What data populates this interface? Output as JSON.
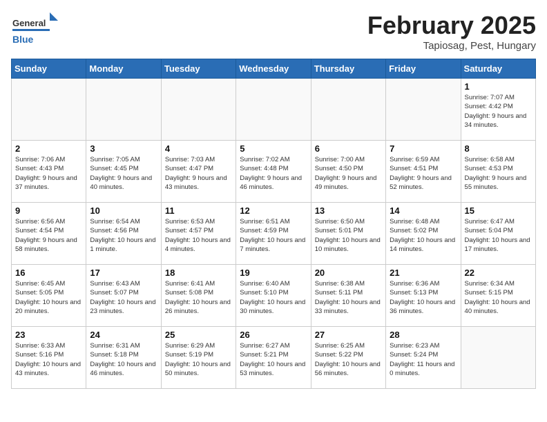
{
  "header": {
    "logo_general": "General",
    "logo_blue": "Blue",
    "month_title": "February 2025",
    "location": "Tapiosag, Pest, Hungary"
  },
  "days_of_week": [
    "Sunday",
    "Monday",
    "Tuesday",
    "Wednesday",
    "Thursday",
    "Friday",
    "Saturday"
  ],
  "weeks": [
    [
      {
        "day": "",
        "info": ""
      },
      {
        "day": "",
        "info": ""
      },
      {
        "day": "",
        "info": ""
      },
      {
        "day": "",
        "info": ""
      },
      {
        "day": "",
        "info": ""
      },
      {
        "day": "",
        "info": ""
      },
      {
        "day": "1",
        "info": "Sunrise: 7:07 AM\nSunset: 4:42 PM\nDaylight: 9 hours and 34 minutes."
      }
    ],
    [
      {
        "day": "2",
        "info": "Sunrise: 7:06 AM\nSunset: 4:43 PM\nDaylight: 9 hours and 37 minutes."
      },
      {
        "day": "3",
        "info": "Sunrise: 7:05 AM\nSunset: 4:45 PM\nDaylight: 9 hours and 40 minutes."
      },
      {
        "day": "4",
        "info": "Sunrise: 7:03 AM\nSunset: 4:47 PM\nDaylight: 9 hours and 43 minutes."
      },
      {
        "day": "5",
        "info": "Sunrise: 7:02 AM\nSunset: 4:48 PM\nDaylight: 9 hours and 46 minutes."
      },
      {
        "day": "6",
        "info": "Sunrise: 7:00 AM\nSunset: 4:50 PM\nDaylight: 9 hours and 49 minutes."
      },
      {
        "day": "7",
        "info": "Sunrise: 6:59 AM\nSunset: 4:51 PM\nDaylight: 9 hours and 52 minutes."
      },
      {
        "day": "8",
        "info": "Sunrise: 6:58 AM\nSunset: 4:53 PM\nDaylight: 9 hours and 55 minutes."
      }
    ],
    [
      {
        "day": "9",
        "info": "Sunrise: 6:56 AM\nSunset: 4:54 PM\nDaylight: 9 hours and 58 minutes."
      },
      {
        "day": "10",
        "info": "Sunrise: 6:54 AM\nSunset: 4:56 PM\nDaylight: 10 hours and 1 minute."
      },
      {
        "day": "11",
        "info": "Sunrise: 6:53 AM\nSunset: 4:57 PM\nDaylight: 10 hours and 4 minutes."
      },
      {
        "day": "12",
        "info": "Sunrise: 6:51 AM\nSunset: 4:59 PM\nDaylight: 10 hours and 7 minutes."
      },
      {
        "day": "13",
        "info": "Sunrise: 6:50 AM\nSunset: 5:01 PM\nDaylight: 10 hours and 10 minutes."
      },
      {
        "day": "14",
        "info": "Sunrise: 6:48 AM\nSunset: 5:02 PM\nDaylight: 10 hours and 14 minutes."
      },
      {
        "day": "15",
        "info": "Sunrise: 6:47 AM\nSunset: 5:04 PM\nDaylight: 10 hours and 17 minutes."
      }
    ],
    [
      {
        "day": "16",
        "info": "Sunrise: 6:45 AM\nSunset: 5:05 PM\nDaylight: 10 hours and 20 minutes."
      },
      {
        "day": "17",
        "info": "Sunrise: 6:43 AM\nSunset: 5:07 PM\nDaylight: 10 hours and 23 minutes."
      },
      {
        "day": "18",
        "info": "Sunrise: 6:41 AM\nSunset: 5:08 PM\nDaylight: 10 hours and 26 minutes."
      },
      {
        "day": "19",
        "info": "Sunrise: 6:40 AM\nSunset: 5:10 PM\nDaylight: 10 hours and 30 minutes."
      },
      {
        "day": "20",
        "info": "Sunrise: 6:38 AM\nSunset: 5:11 PM\nDaylight: 10 hours and 33 minutes."
      },
      {
        "day": "21",
        "info": "Sunrise: 6:36 AM\nSunset: 5:13 PM\nDaylight: 10 hours and 36 minutes."
      },
      {
        "day": "22",
        "info": "Sunrise: 6:34 AM\nSunset: 5:15 PM\nDaylight: 10 hours and 40 minutes."
      }
    ],
    [
      {
        "day": "23",
        "info": "Sunrise: 6:33 AM\nSunset: 5:16 PM\nDaylight: 10 hours and 43 minutes."
      },
      {
        "day": "24",
        "info": "Sunrise: 6:31 AM\nSunset: 5:18 PM\nDaylight: 10 hours and 46 minutes."
      },
      {
        "day": "25",
        "info": "Sunrise: 6:29 AM\nSunset: 5:19 PM\nDaylight: 10 hours and 50 minutes."
      },
      {
        "day": "26",
        "info": "Sunrise: 6:27 AM\nSunset: 5:21 PM\nDaylight: 10 hours and 53 minutes."
      },
      {
        "day": "27",
        "info": "Sunrise: 6:25 AM\nSunset: 5:22 PM\nDaylight: 10 hours and 56 minutes."
      },
      {
        "day": "28",
        "info": "Sunrise: 6:23 AM\nSunset: 5:24 PM\nDaylight: 11 hours and 0 minutes."
      },
      {
        "day": "",
        "info": ""
      }
    ]
  ]
}
